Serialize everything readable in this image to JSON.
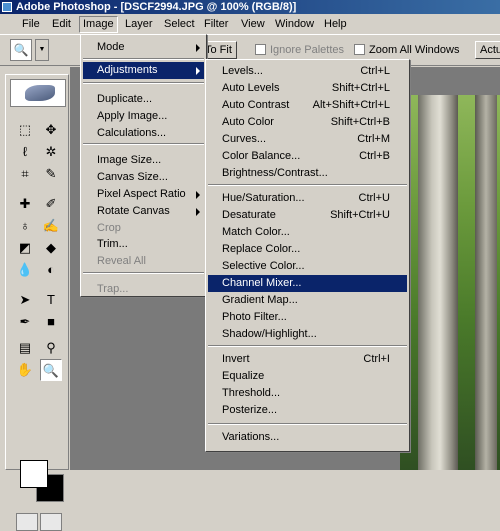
{
  "window": {
    "title": "Adobe Photoshop - [DSCF2994.JPG @ 100% (RGB/8)]"
  },
  "menubar": [
    "File",
    "Edit",
    "Image",
    "Layer",
    "Select",
    "Filter",
    "View",
    "Window",
    "Help"
  ],
  "optionsbar": {
    "tool_preset_icon": "magnifier-icon",
    "fit_label": "To Fit",
    "ignore_palettes_label": "Ignore Palettes",
    "zoom_all_label": "Zoom All Windows",
    "actual_pixels_label": "Actu"
  },
  "image_menu": {
    "items": [
      {
        "label": "Mode",
        "submenu": true
      },
      {
        "label": "Adjustments",
        "submenu": true,
        "highlighted": true
      },
      {
        "label": "Duplicate..."
      },
      {
        "label": "Apply Image..."
      },
      {
        "label": "Calculations..."
      },
      {
        "label": "Image Size..."
      },
      {
        "label": "Canvas Size..."
      },
      {
        "label": "Pixel Aspect Ratio",
        "submenu": true
      },
      {
        "label": "Rotate Canvas",
        "submenu": true
      },
      {
        "label": "Crop",
        "disabled": true
      },
      {
        "label": "Trim..."
      },
      {
        "label": "Reveal All",
        "disabled": true
      },
      {
        "label": "Trap...",
        "disabled": true
      }
    ]
  },
  "adjustments_menu": {
    "items": [
      {
        "label": "Levels...",
        "shortcut": "Ctrl+L"
      },
      {
        "label": "Auto Levels",
        "shortcut": "Shift+Ctrl+L"
      },
      {
        "label": "Auto Contrast",
        "shortcut": "Alt+Shift+Ctrl+L"
      },
      {
        "label": "Auto Color",
        "shortcut": "Shift+Ctrl+B"
      },
      {
        "label": "Curves...",
        "shortcut": "Ctrl+M"
      },
      {
        "label": "Color Balance...",
        "shortcut": "Ctrl+B"
      },
      {
        "label": "Brightness/Contrast...",
        "shortcut": ""
      },
      {
        "label": "Hue/Saturation...",
        "shortcut": "Ctrl+U"
      },
      {
        "label": "Desaturate",
        "shortcut": "Shift+Ctrl+U"
      },
      {
        "label": "Match Color...",
        "shortcut": ""
      },
      {
        "label": "Replace Color...",
        "shortcut": ""
      },
      {
        "label": "Selective Color...",
        "shortcut": ""
      },
      {
        "label": "Channel Mixer...",
        "shortcut": "",
        "highlighted": true
      },
      {
        "label": "Gradient Map...",
        "shortcut": ""
      },
      {
        "label": "Photo Filter...",
        "shortcut": ""
      },
      {
        "label": "Shadow/Highlight...",
        "shortcut": ""
      },
      {
        "label": "Invert",
        "shortcut": "Ctrl+I"
      },
      {
        "label": "Equalize",
        "shortcut": ""
      },
      {
        "label": "Threshold...",
        "shortcut": ""
      },
      {
        "label": "Posterize...",
        "shortcut": ""
      },
      {
        "label": "Variations...",
        "shortcut": ""
      }
    ]
  },
  "toolbox": {
    "tools": [
      "marquee-icon",
      "move-icon",
      "lasso-icon",
      "magic-wand-icon",
      "crop-icon",
      "slice-icon",
      "healing-brush-icon",
      "brush-icon",
      "clone-stamp-icon",
      "history-brush-icon",
      "eraser-icon",
      "paint-bucket-icon",
      "blur-icon",
      "dodge-icon",
      "path-selection-icon",
      "type-icon",
      "pen-icon",
      "shape-icon",
      "notes-icon",
      "eyedropper-icon",
      "hand-icon",
      "zoom-icon"
    ],
    "tool_glyphs": [
      "⬚",
      "✥",
      "ℓ",
      "✲",
      "⌗",
      "✎",
      "✚",
      "✐",
      "♁",
      "✍",
      "◩",
      "◆",
      "💧",
      "◐",
      "➤",
      "T",
      "✒",
      "■",
      "▤",
      "⚲",
      "✋",
      "🔍"
    ],
    "selected_tool": "zoom-icon",
    "foreground_color": "#ffffff",
    "background_color": "#000000"
  }
}
